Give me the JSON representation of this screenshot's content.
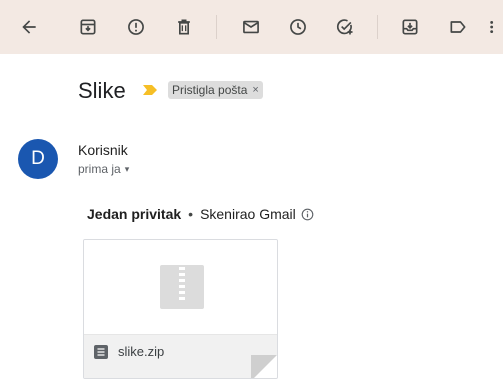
{
  "subject": {
    "title": "Slike",
    "label": "Pristigla pošta",
    "label_remove": "×"
  },
  "toolbar": {
    "buttons": [
      {
        "name": "back-button",
        "icon": "arrow-left-icon"
      },
      {
        "name": "archive-button",
        "icon": "archive-icon"
      },
      {
        "name": "report-spam-button",
        "icon": "report-spam-icon"
      },
      {
        "name": "delete-button",
        "icon": "trash-icon"
      },
      {
        "name": "mark-unread-button",
        "icon": "envelope-icon"
      },
      {
        "name": "snooze-button",
        "icon": "clock-icon"
      },
      {
        "name": "add-to-tasks-button",
        "icon": "add-task-icon"
      },
      {
        "name": "move-to-button",
        "icon": "move-to-inbox-icon"
      },
      {
        "name": "labels-button",
        "icon": "label-icon"
      },
      {
        "name": "more-button",
        "icon": "more-vert-icon"
      }
    ]
  },
  "message": {
    "avatar_letter": "D",
    "sender": "Korisnik",
    "recipient": "prima ja",
    "recipient_caret": "▾"
  },
  "attachments": {
    "count_label": "Jedan privitak",
    "separator": "•",
    "scan_label": "Skenirao Gmail",
    "files": [
      {
        "name": "slike.zip",
        "icon": "zip-file-icon"
      }
    ]
  },
  "colors": {
    "toolbar_bg": "#f3e9e3",
    "avatar_bg": "#1a57b0",
    "importance": "#f6bf26",
    "label_chip_bg": "#dddddd"
  }
}
